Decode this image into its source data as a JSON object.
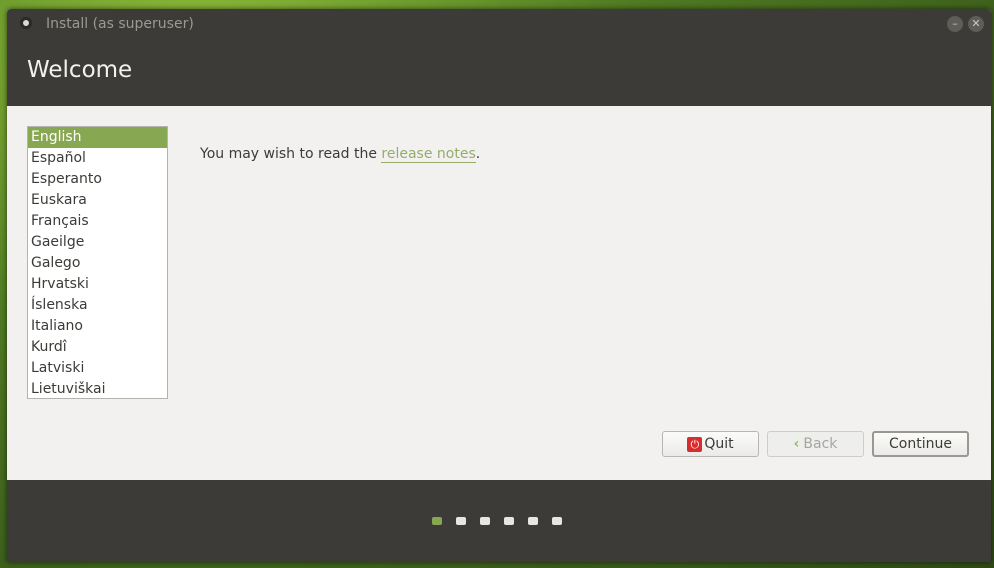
{
  "window": {
    "title": "Install (as superuser)"
  },
  "header": {
    "title": "Welcome"
  },
  "languages": {
    "selected": "English",
    "items": [
      "English",
      "Español",
      "Esperanto",
      "Euskara",
      "Français",
      "Gaeilge",
      "Galego",
      "Hrvatski",
      "Íslenska",
      "Italiano",
      "Kurdî",
      "Latviski",
      "Lietuviškai"
    ]
  },
  "content": {
    "intro_prefix": "You may wish to read the ",
    "link_text": "release notes",
    "intro_suffix": "."
  },
  "buttons": {
    "quit": "Quit",
    "back": "Back",
    "continue": "Continue"
  },
  "progress": {
    "total_steps": 6,
    "current_step": 1
  },
  "colors": {
    "accent": "#87a752",
    "dark": "#3c3b37",
    "link": "#94ad6a"
  },
  "icons": {
    "window": "app-icon",
    "close": "close-icon",
    "quit": "power-icon",
    "back": "chevron-left-icon"
  }
}
